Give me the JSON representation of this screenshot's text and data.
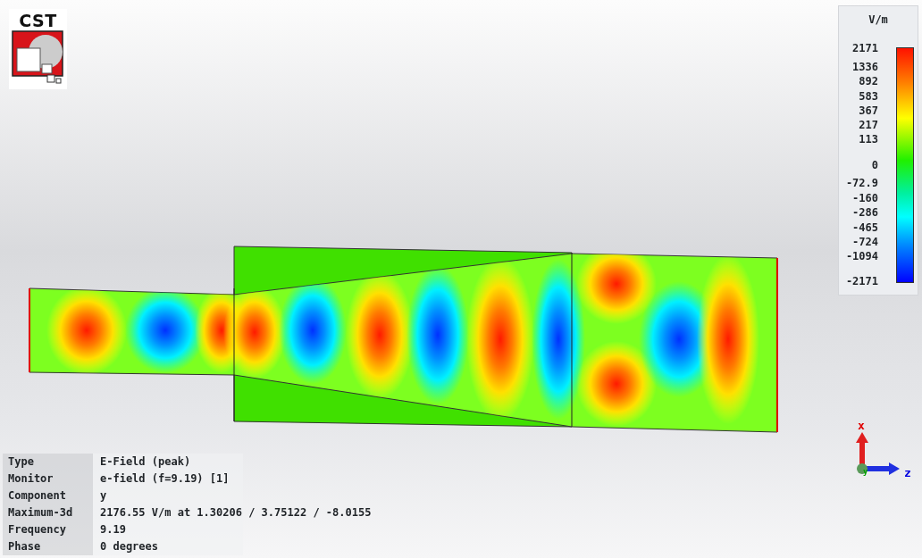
{
  "logo": {
    "text": "CST"
  },
  "legend": {
    "unit": "V/m",
    "ticks": [
      "2171",
      "1336",
      "892",
      "583",
      "367",
      "217",
      "113",
      "0",
      "-72.9",
      "-160",
      "-286",
      "-465",
      "-724",
      "-1094",
      "-2171"
    ]
  },
  "axes": {
    "labels": [
      "x",
      "y",
      "z"
    ]
  },
  "info": [
    {
      "label": "Type",
      "value": "E-Field (peak)"
    },
    {
      "label": "Monitor",
      "value": "e-field (f=9.19) [1]"
    },
    {
      "label": "Component",
      "value": "y"
    },
    {
      "label": "Maximum-3d",
      "value": "2176.55 V/m at 1.30206 / 3.75122 / -8.0155"
    },
    {
      "label": "Frequency",
      "value": "9.19"
    },
    {
      "label": "Phase",
      "value": "0 degrees"
    }
  ]
}
